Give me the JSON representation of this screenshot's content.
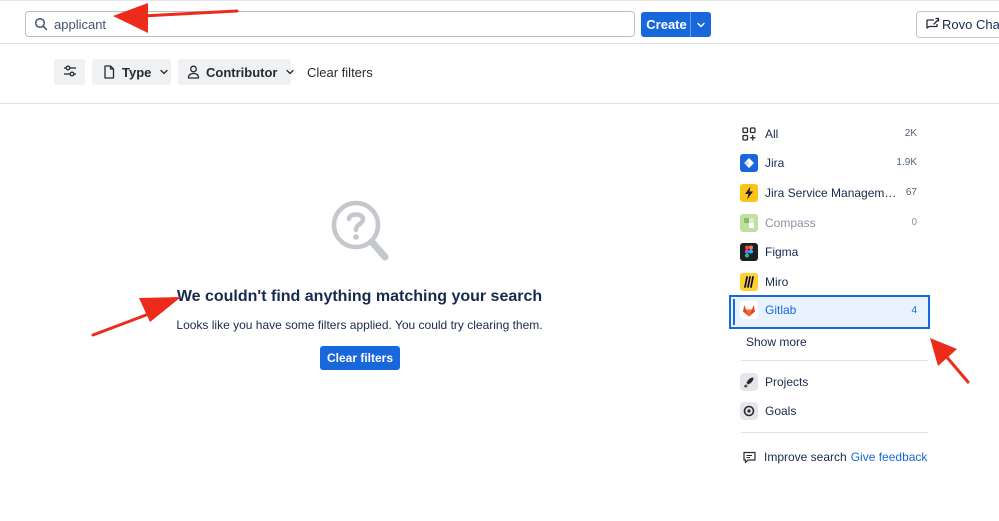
{
  "search": {
    "value": "applicant"
  },
  "header": {
    "create_label": "Create",
    "rovo_label": "Rovo Chat"
  },
  "filters": {
    "type_label": "Type",
    "contributor_label": "Contributor",
    "clear_label": "Clear filters"
  },
  "empty_state": {
    "title": "We couldn't find anything matching your search",
    "subtitle": "Looks like you have some filters applied. You could try clearing them.",
    "button_label": "Clear filters"
  },
  "sidebar": {
    "products": [
      {
        "label": "All",
        "count": "2K",
        "icon": "grid-icon"
      },
      {
        "label": "Jira",
        "count": "1.9K",
        "icon": "jira-icon",
        "color": "#1868db"
      },
      {
        "label": "Jira Service Management",
        "count": "67",
        "icon": "lightning-icon",
        "color": "#fcc419"
      },
      {
        "label": "Compass",
        "count": "0",
        "icon": "compass-icon",
        "color": "#94c748"
      },
      {
        "label": "Figma",
        "count": "",
        "icon": "figma-icon",
        "color": "#1e1f21"
      },
      {
        "label": "Miro",
        "count": "",
        "icon": "miro-icon",
        "color": "#ffd02f"
      },
      {
        "label": "Gitlab",
        "count": "4",
        "icon": "gitlab-icon",
        "color": "#e24329"
      }
    ],
    "show_more": "Show more",
    "links": [
      {
        "label": "Projects",
        "icon": "rocket-icon"
      },
      {
        "label": "Goals",
        "icon": "target-icon"
      }
    ],
    "improve_label": "Improve search",
    "feedback_label": "Give feedback"
  },
  "colors": {
    "accent": "#1868db",
    "annotation": "#ee2b1b"
  }
}
